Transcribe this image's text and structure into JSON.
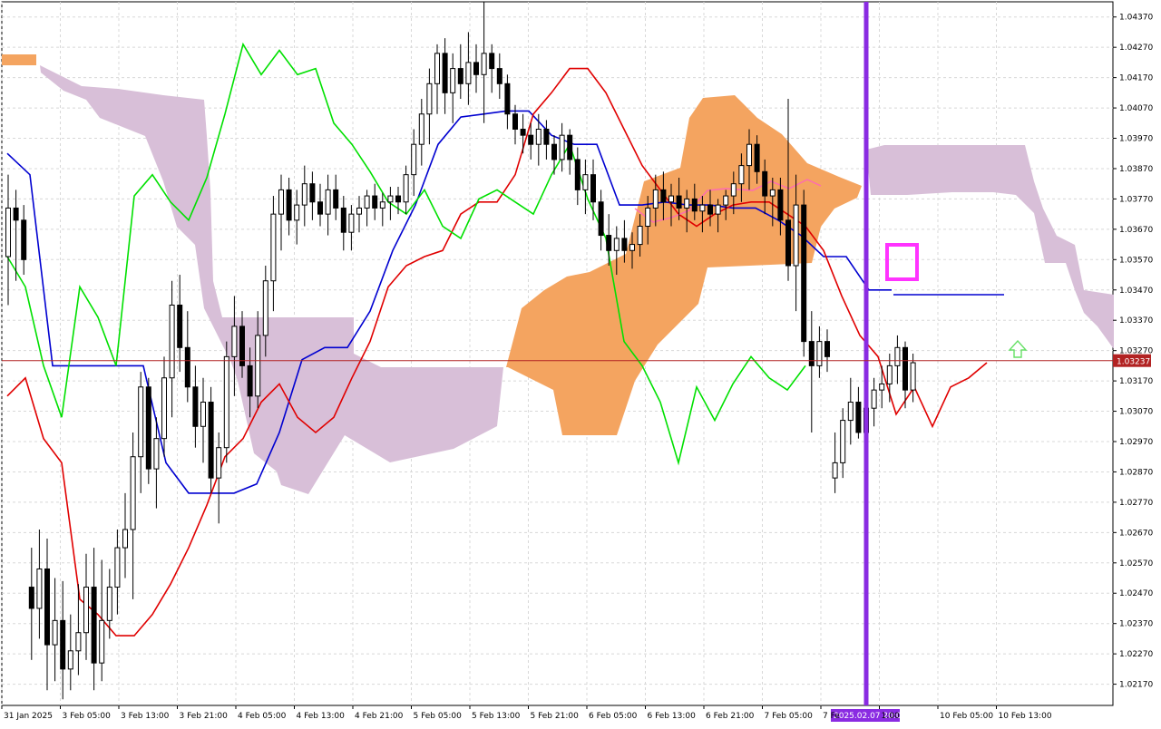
{
  "colors": {
    "background": "#ffffff",
    "grid": "#d8d8d8",
    "axis": "#000000",
    "candle_bull_fill": "#ffffff",
    "candle_bear_fill": "#000000",
    "candle_stroke": "#000000",
    "tenkan": "#e00000",
    "kijun": "#0000d0",
    "chikou": "#00e000",
    "kumo_bull": "#f4a460",
    "kumo_bear": "#d8bfd8",
    "current_price": "#b22222",
    "vertical_marker": "#8a2be2",
    "highlight_box": "#ff33ff",
    "forecast_line": "#ff69b4",
    "arrow": "#66e066"
  },
  "chart_data": {
    "type": "candlestick",
    "symbol_hint": "",
    "y_axis": {
      "min": 1.021,
      "max": 1.0442,
      "ticks": [
        "1.04370",
        "1.04270",
        "1.04170",
        "1.04070",
        "1.03970",
        "1.03870",
        "1.03770",
        "1.03670",
        "1.03570",
        "1.03470",
        "1.03370",
        "1.03270",
        "1.03170",
        "1.03070",
        "1.02970",
        "1.02870",
        "1.02770",
        "1.02670",
        "1.02570",
        "1.02470",
        "1.02370",
        "1.02270",
        "1.02170"
      ],
      "current_price_label": "1.03237",
      "current_price": 1.03237
    },
    "x_axis": {
      "ticks": [
        "31 Jan 2025",
        "3 Feb 05:00",
        "3 Feb 13:00",
        "3 Feb 21:00",
        "4 Feb 05:00",
        "4 Feb 13:00",
        "4 Feb 21:00",
        "5 Feb 05:00",
        "5 Feb 13:00",
        "5 Feb 21:00",
        "6 Feb 05:00",
        "6 Feb 13:00",
        "6 Feb 21:00",
        "7 Feb 05:00",
        "7 Fe",
        "1:00",
        "10 Feb 05:00",
        "10 Feb 13:00"
      ],
      "highlight_label": "2025.02.07 20:00"
    },
    "grid": true,
    "candles": [
      {
        "o": 1.0358,
        "h": 1.0385,
        "l": 1.0342,
        "c": 1.0374
      },
      {
        "o": 1.0374,
        "h": 1.038,
        "l": 1.035,
        "c": 1.037
      },
      {
        "o": 1.037,
        "h": 1.0375,
        "l": 1.0352,
        "c": 1.0357
      },
      {
        "o": 1.0249,
        "h": 1.0262,
        "l": 1.0225,
        "c": 1.0242
      },
      {
        "o": 1.0242,
        "h": 1.0268,
        "l": 1.0232,
        "c": 1.0255
      },
      {
        "o": 1.0255,
        "h": 1.0265,
        "l": 1.0215,
        "c": 1.023
      },
      {
        "o": 1.023,
        "h": 1.0252,
        "l": 1.0218,
        "c": 1.0238
      },
      {
        "o": 1.0238,
        "h": 1.0251,
        "l": 1.0212,
        "c": 1.0222
      },
      {
        "o": 1.0222,
        "h": 1.024,
        "l": 1.0215,
        "c": 1.0228
      },
      {
        "o": 1.0228,
        "h": 1.025,
        "l": 1.022,
        "c": 1.0234
      },
      {
        "o": 1.0234,
        "h": 1.026,
        "l": 1.0225,
        "c": 1.0249
      },
      {
        "o": 1.0249,
        "h": 1.0262,
        "l": 1.0215,
        "c": 1.0224
      },
      {
        "o": 1.0224,
        "h": 1.0258,
        "l": 1.0218,
        "c": 1.0238
      },
      {
        "o": 1.0238,
        "h": 1.0255,
        "l": 1.0232,
        "c": 1.0249
      },
      {
        "o": 1.0249,
        "h": 1.0268,
        "l": 1.024,
        "c": 1.0262
      },
      {
        "o": 1.0262,
        "h": 1.028,
        "l": 1.0252,
        "c": 1.0268
      },
      {
        "o": 1.0268,
        "h": 1.03,
        "l": 1.0245,
        "c": 1.0292
      },
      {
        "o": 1.0292,
        "h": 1.032,
        "l": 1.028,
        "c": 1.0315
      },
      {
        "o": 1.0315,
        "h": 1.0318,
        "l": 1.0283,
        "c": 1.0288
      },
      {
        "o": 1.0288,
        "h": 1.0305,
        "l": 1.0275,
        "c": 1.0298
      },
      {
        "o": 1.0298,
        "h": 1.0325,
        "l": 1.0292,
        "c": 1.0318
      },
      {
        "o": 1.0318,
        "h": 1.035,
        "l": 1.0305,
        "c": 1.0342
      },
      {
        "o": 1.0342,
        "h": 1.0352,
        "l": 1.032,
        "c": 1.0328
      },
      {
        "o": 1.0328,
        "h": 1.034,
        "l": 1.031,
        "c": 1.0315
      },
      {
        "o": 1.0315,
        "h": 1.0322,
        "l": 1.0295,
        "c": 1.0302
      },
      {
        "o": 1.0302,
        "h": 1.0318,
        "l": 1.029,
        "c": 1.031
      },
      {
        "o": 1.031,
        "h": 1.0315,
        "l": 1.028,
        "c": 1.0285
      },
      {
        "o": 1.0285,
        "h": 1.03,
        "l": 1.027,
        "c": 1.0295
      },
      {
        "o": 1.0295,
        "h": 1.033,
        "l": 1.029,
        "c": 1.0325
      },
      {
        "o": 1.0325,
        "h": 1.0345,
        "l": 1.0312,
        "c": 1.0335
      },
      {
        "o": 1.0335,
        "h": 1.034,
        "l": 1.0318,
        "c": 1.0322
      },
      {
        "o": 1.0322,
        "h": 1.0328,
        "l": 1.0305,
        "c": 1.0312
      },
      {
        "o": 1.0312,
        "h": 1.034,
        "l": 1.0308,
        "c": 1.0332
      },
      {
        "o": 1.0332,
        "h": 1.0355,
        "l": 1.0325,
        "c": 1.035
      },
      {
        "o": 1.035,
        "h": 1.0378,
        "l": 1.034,
        "c": 1.0372
      },
      {
        "o": 1.0372,
        "h": 1.0385,
        "l": 1.036,
        "c": 1.038
      },
      {
        "o": 1.038,
        "h": 1.0384,
        "l": 1.0365,
        "c": 1.037
      },
      {
        "o": 1.037,
        "h": 1.038,
        "l": 1.0362,
        "c": 1.0375
      },
      {
        "o": 1.0375,
        "h": 1.0388,
        "l": 1.0368,
        "c": 1.0382
      },
      {
        "o": 1.0382,
        "h": 1.0386,
        "l": 1.037,
        "c": 1.0376
      },
      {
        "o": 1.0376,
        "h": 1.0382,
        "l": 1.0368,
        "c": 1.0372
      },
      {
        "o": 1.0372,
        "h": 1.0385,
        "l": 1.0365,
        "c": 1.038
      },
      {
        "o": 1.038,
        "h": 1.0385,
        "l": 1.037,
        "c": 1.0374
      },
      {
        "o": 1.0374,
        "h": 1.0378,
        "l": 1.036,
        "c": 1.0366
      },
      {
        "o": 1.0366,
        "h": 1.0375,
        "l": 1.036,
        "c": 1.0372
      },
      {
        "o": 1.0372,
        "h": 1.0378,
        "l": 1.0366,
        "c": 1.0374
      },
      {
        "o": 1.0374,
        "h": 1.038,
        "l": 1.0368,
        "c": 1.0378
      },
      {
        "o": 1.0378,
        "h": 1.0382,
        "l": 1.037,
        "c": 1.0374
      },
      {
        "o": 1.0374,
        "h": 1.0379,
        "l": 1.0368,
        "c": 1.0376
      },
      {
        "o": 1.0376,
        "h": 1.0381,
        "l": 1.037,
        "c": 1.0378
      },
      {
        "o": 1.0378,
        "h": 1.0381,
        "l": 1.0372,
        "c": 1.0376
      },
      {
        "o": 1.0376,
        "h": 1.0388,
        "l": 1.0372,
        "c": 1.0385
      },
      {
        "o": 1.0385,
        "h": 1.04,
        "l": 1.0378,
        "c": 1.0395
      },
      {
        "o": 1.0395,
        "h": 1.041,
        "l": 1.0388,
        "c": 1.0405
      },
      {
        "o": 1.0405,
        "h": 1.042,
        "l": 1.0395,
        "c": 1.0415
      },
      {
        "o": 1.0415,
        "h": 1.0428,
        "l": 1.0405,
        "c": 1.0425
      },
      {
        "o": 1.0425,
        "h": 1.043,
        "l": 1.0405,
        "c": 1.0412
      },
      {
        "o": 1.0412,
        "h": 1.0425,
        "l": 1.0402,
        "c": 1.042
      },
      {
        "o": 1.042,
        "h": 1.0428,
        "l": 1.041,
        "c": 1.0415
      },
      {
        "o": 1.0415,
        "h": 1.0432,
        "l": 1.0408,
        "c": 1.0422
      },
      {
        "o": 1.0422,
        "h": 1.0428,
        "l": 1.0412,
        "c": 1.0418
      },
      {
        "o": 1.0418,
        "h": 1.0442,
        "l": 1.0402,
        "c": 1.0425
      },
      {
        "o": 1.0425,
        "h": 1.0428,
        "l": 1.0412,
        "c": 1.042
      },
      {
        "o": 1.042,
        "h": 1.0425,
        "l": 1.041,
        "c": 1.0415
      },
      {
        "o": 1.0415,
        "h": 1.0418,
        "l": 1.04,
        "c": 1.0405
      },
      {
        "o": 1.0405,
        "h": 1.0408,
        "l": 1.0395,
        "c": 1.04
      },
      {
        "o": 1.04,
        "h": 1.0405,
        "l": 1.0392,
        "c": 1.0398
      },
      {
        "o": 1.0398,
        "h": 1.0402,
        "l": 1.039,
        "c": 1.0395
      },
      {
        "o": 1.0395,
        "h": 1.0405,
        "l": 1.0388,
        "c": 1.04
      },
      {
        "o": 1.04,
        "h": 1.0403,
        "l": 1.039,
        "c": 1.0395
      },
      {
        "o": 1.0395,
        "h": 1.0398,
        "l": 1.0385,
        "c": 1.039
      },
      {
        "o": 1.039,
        "h": 1.0402,
        "l": 1.0386,
        "c": 1.0398
      },
      {
        "o": 1.0398,
        "h": 1.04,
        "l": 1.0385,
        "c": 1.039
      },
      {
        "o": 1.039,
        "h": 1.0394,
        "l": 1.0375,
        "c": 1.038
      },
      {
        "o": 1.038,
        "h": 1.039,
        "l": 1.0372,
        "c": 1.0385
      },
      {
        "o": 1.0385,
        "h": 1.039,
        "l": 1.037,
        "c": 1.0376
      },
      {
        "o": 1.0376,
        "h": 1.038,
        "l": 1.036,
        "c": 1.0365
      },
      {
        "o": 1.0365,
        "h": 1.0372,
        "l": 1.0355,
        "c": 1.036
      },
      {
        "o": 1.036,
        "h": 1.0368,
        "l": 1.0352,
        "c": 1.0364
      },
      {
        "o": 1.0364,
        "h": 1.037,
        "l": 1.0356,
        "c": 1.036
      },
      {
        "o": 1.036,
        "h": 1.0366,
        "l": 1.0354,
        "c": 1.0362
      },
      {
        "o": 1.0362,
        "h": 1.0372,
        "l": 1.0358,
        "c": 1.0368
      },
      {
        "o": 1.0368,
        "h": 1.0378,
        "l": 1.0362,
        "c": 1.0374
      },
      {
        "o": 1.0374,
        "h": 1.0385,
        "l": 1.0368,
        "c": 1.038
      },
      {
        "o": 1.038,
        "h": 1.0386,
        "l": 1.037,
        "c": 1.0376
      },
      {
        "o": 1.0376,
        "h": 1.0382,
        "l": 1.0368,
        "c": 1.0378
      },
      {
        "o": 1.0378,
        "h": 1.0384,
        "l": 1.037,
        "c": 1.0374
      },
      {
        "o": 1.0374,
        "h": 1.038,
        "l": 1.0366,
        "c": 1.0377
      },
      {
        "o": 1.0377,
        "h": 1.0382,
        "l": 1.037,
        "c": 1.0373
      },
      {
        "o": 1.0373,
        "h": 1.0378,
        "l": 1.0366,
        "c": 1.0375
      },
      {
        "o": 1.0375,
        "h": 1.038,
        "l": 1.0368,
        "c": 1.0372
      },
      {
        "o": 1.0372,
        "h": 1.0377,
        "l": 1.0366,
        "c": 1.0375
      },
      {
        "o": 1.0375,
        "h": 1.038,
        "l": 1.037,
        "c": 1.0378
      },
      {
        "o": 1.0378,
        "h": 1.0386,
        "l": 1.0372,
        "c": 1.0382
      },
      {
        "o": 1.0382,
        "h": 1.0392,
        "l": 1.0376,
        "c": 1.0388
      },
      {
        "o": 1.0388,
        "h": 1.04,
        "l": 1.038,
        "c": 1.0395
      },
      {
        "o": 1.0395,
        "h": 1.0398,
        "l": 1.0382,
        "c": 1.0386
      },
      {
        "o": 1.0386,
        "h": 1.039,
        "l": 1.0372,
        "c": 1.0378
      },
      {
        "o": 1.0378,
        "h": 1.0384,
        "l": 1.0368,
        "c": 1.038
      },
      {
        "o": 1.038,
        "h": 1.0384,
        "l": 1.0365,
        "c": 1.037
      },
      {
        "o": 1.037,
        "h": 1.041,
        "l": 1.035,
        "c": 1.0355
      },
      {
        "o": 1.0355,
        "h": 1.0385,
        "l": 1.034,
        "c": 1.0375
      },
      {
        "o": 1.0375,
        "h": 1.038,
        "l": 1.0325,
        "c": 1.033
      },
      {
        "o": 1.033,
        "h": 1.034,
        "l": 1.03,
        "c": 1.0322
      },
      {
        "o": 1.0322,
        "h": 1.0335,
        "l": 1.0318,
        "c": 1.033
      },
      {
        "o": 1.033,
        "h": 1.0334,
        "l": 1.032,
        "c": 1.0325
      },
      {
        "o": 1.0285,
        "h": 1.03,
        "l": 1.028,
        "c": 1.029
      },
      {
        "o": 1.029,
        "h": 1.0308,
        "l": 1.0285,
        "c": 1.0304
      },
      {
        "o": 1.0304,
        "h": 1.0318,
        "l": 1.0296,
        "c": 1.031
      },
      {
        "o": 1.031,
        "h": 1.0315,
        "l": 1.0298,
        "c": 1.03
      },
      {
        "o": 1.03,
        "h": 1.0312,
        "l": 1.0296,
        "c": 1.0308
      },
      {
        "o": 1.0308,
        "h": 1.0318,
        "l": 1.0302,
        "c": 1.0314
      },
      {
        "o": 1.0314,
        "h": 1.0322,
        "l": 1.0308,
        "c": 1.0316
      },
      {
        "o": 1.0316,
        "h": 1.0326,
        "l": 1.031,
        "c": 1.0322
      },
      {
        "o": 1.0322,
        "h": 1.0332,
        "l": 1.0316,
        "c": 1.0328
      },
      {
        "o": 1.0328,
        "h": 1.033,
        "l": 1.0308,
        "c": 1.0314
      },
      {
        "o": 1.0314,
        "h": 1.0326,
        "l": 1.031,
        "c": 1.0323
      }
    ],
    "series": [
      {
        "key": "tenkan",
        "values": [
          1.0312,
          1.0318,
          1.0298,
          1.029,
          1.0245,
          1.024,
          1.0233,
          1.0233,
          1.024,
          1.025,
          1.0262,
          1.0276,
          1.0292,
          1.0298,
          1.031,
          1.0316,
          1.0305,
          1.03,
          1.0305,
          1.0318,
          1.033,
          1.0348,
          1.0355,
          1.0358,
          1.036,
          1.0372,
          1.0376,
          1.0376,
          1.0385,
          1.0405,
          1.0412,
          1.042,
          1.042,
          1.0412,
          1.04,
          1.0388,
          1.038,
          1.0372,
          1.0368,
          1.0372,
          1.0375,
          1.0376,
          1.0376,
          1.0372,
          1.0368,
          1.036,
          1.0345,
          1.0332,
          1.0325,
          1.0306,
          1.0315,
          1.0302,
          1.0315,
          1.0318,
          1.0323
        ]
      },
      {
        "key": "kijun",
        "values": [
          1.0392,
          1.0385,
          1.0322,
          1.0322,
          1.0322,
          1.0322,
          1.0322,
          1.029,
          1.028,
          1.028,
          1.028,
          1.0283,
          1.03,
          1.0324,
          1.0328,
          1.0328,
          1.034,
          1.036,
          1.0375,
          1.0395,
          1.0404,
          1.0405,
          1.0406,
          1.0406,
          1.0398,
          1.0395,
          1.0395,
          1.0375,
          1.0375,
          1.0376,
          1.0375,
          1.0375,
          1.0374,
          1.0374,
          1.037,
          1.0365,
          1.0358,
          1.0358,
          1.0347,
          1.0347
        ]
      },
      {
        "key": "chikou",
        "values": [
          1.0358,
          1.0348,
          1.0322,
          1.0305,
          1.0348,
          1.0338,
          1.0322,
          1.0378,
          1.0385,
          1.0376,
          1.037,
          1.0384,
          1.0405,
          1.0428,
          1.0418,
          1.0426,
          1.0418,
          1.042,
          1.0402,
          1.0395,
          1.0386,
          1.0376,
          1.0372,
          1.038,
          1.0368,
          1.0364,
          1.0377,
          1.038,
          1.0376,
          1.0372,
          1.0385,
          1.0395,
          1.0377,
          1.0364,
          1.033,
          1.0322,
          1.031,
          1.029,
          1.0315,
          1.0304,
          1.0316,
          1.0325,
          1.0318,
          1.0314,
          1.0322
        ]
      }
    ]
  }
}
